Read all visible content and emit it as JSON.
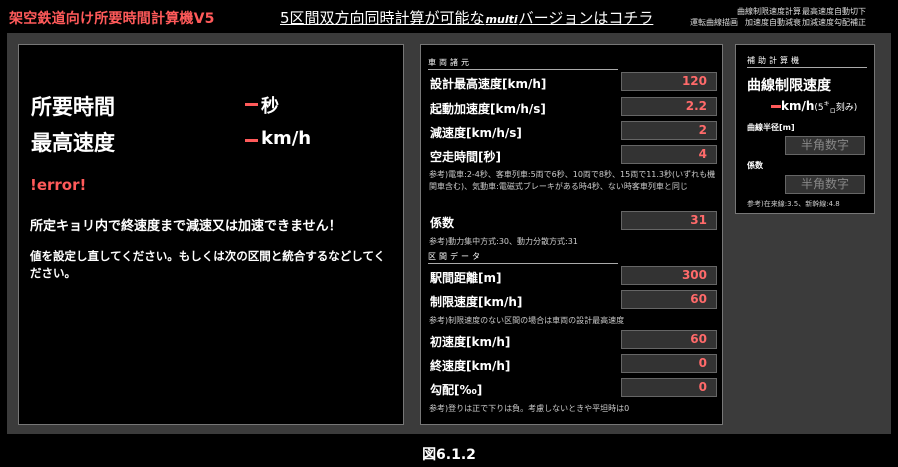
{
  "header": {
    "app_title": "架空鉄道向け所要時間計算機V5",
    "link_before": "5区間双方向同時計算が可能な",
    "link_multi": "multi",
    "link_after": "バージョンはコチラ",
    "menu": [
      "曲線制限速度計算",
      "最高速度自動切下",
      "運転曲線描画",
      "加速度自動減衰",
      "加減速度勾配補正"
    ]
  },
  "result": {
    "time_label": "所要時間",
    "time_unit": "秒",
    "speed_label": "最高速度",
    "speed_unit": "km/h",
    "error_title": "!error!",
    "error_message": "所定キョリ内で終速度まで減速又は加速できません！",
    "error_hint": "値を設定し直してください。もしくは次の区間と統合するなどしてください。"
  },
  "vehicle": {
    "header": "車両諸元",
    "max_speed_label": "設計最高速度[km/h]",
    "max_speed": "120",
    "accel_label": "起動加速度[km/h/s]",
    "accel": "2.2",
    "decel_label": "減速度[km/h/s]",
    "decel": "2",
    "idle_label": "空走時間[秒]",
    "idle": "4",
    "idle_note": "参考)電車:2-4秒、客車列車:5両で6秒、10両で8秒、15両で11.3秒(いずれも機関車含む)、気動車:電磁式ブレーキがある時4秒、ない時客車列車と同じ",
    "coef_label": "係数",
    "coef": "31",
    "coef_note": "参考)動力集中方式:30、動力分散方式:31"
  },
  "section": {
    "header": "区間データ",
    "distance_label": "駅間距離[m]",
    "distance": "300",
    "limit_label": "制限速度[km/h]",
    "limit": "60",
    "limit_note": "参考)制限速度のない区間の場合は車両の設計最高速度",
    "init_label": "初速度[km/h]",
    "init": "60",
    "final_label": "終速度[km/h]",
    "final": "0",
    "grad_label": "勾配[‰]",
    "grad": "0",
    "grad_note": "参考)登りは正で下りは負。考慮しないときや平坦時は0"
  },
  "calc": {
    "header": "補助計算機",
    "title": "曲線制限速度",
    "unit": "km/h",
    "unit_note": "(5",
    "unit_note_sup": "キ",
    "unit_note_sub": "ロ",
    "unit_note_end": "刻み)",
    "radius_label": "曲線半径[m]",
    "radius_placeholder": "半角数字",
    "coef_label": "係数",
    "coef_placeholder": "半角数字",
    "note": "参考)在来線:3.5、新幹線:4.8"
  },
  "caption": "図6.1.2",
  "colors": {
    "accent": "#ff5a5a",
    "panel": "#000000",
    "frame": "#3b3b3b",
    "input_bg": "#333333"
  }
}
